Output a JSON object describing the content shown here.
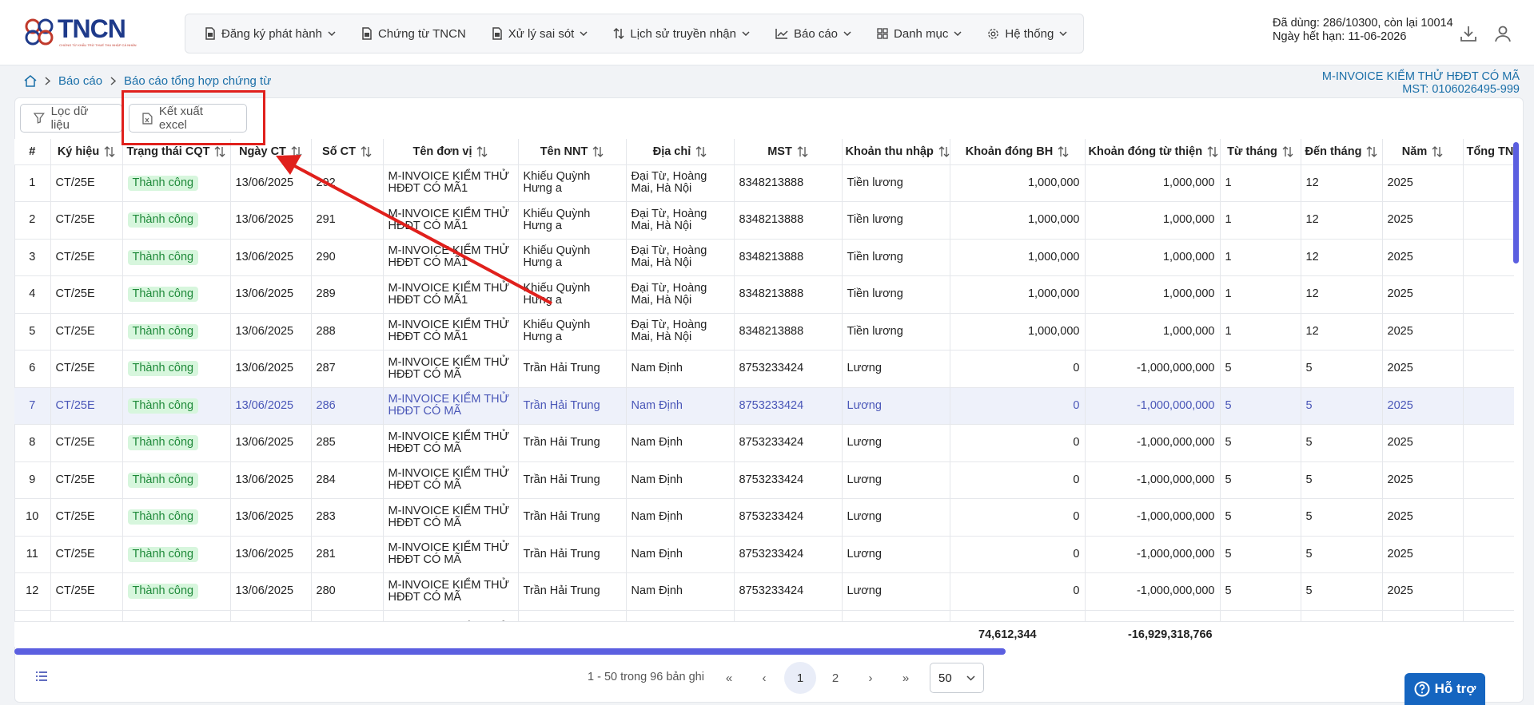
{
  "header": {
    "logo_text": "TNCN",
    "logo_sub": "CHỨNG TỪ KHẤU TRỪ THUẾ THU NHẬP CÁ NHÂN",
    "nav": [
      {
        "label": "Đăng ký phát hành",
        "icon": "document-icon",
        "dropdown": true
      },
      {
        "label": "Chứng từ TNCN",
        "icon": "document-icon",
        "dropdown": false
      },
      {
        "label": "Xử lý sai sót",
        "icon": "document-icon",
        "dropdown": true
      },
      {
        "label": "Lịch sử truyền nhận",
        "icon": "transfer-icon",
        "dropdown": true
      },
      {
        "label": "Báo cáo",
        "icon": "chart-icon",
        "dropdown": true
      },
      {
        "label": "Danh mục",
        "icon": "grid-icon",
        "dropdown": true
      },
      {
        "label": "Hệ thống",
        "icon": "gear-icon",
        "dropdown": true
      }
    ],
    "usage": "Đã dùng: 286/10300, còn lại 10014",
    "expiry": "Ngày hết hạn: 11-06-2026"
  },
  "breadcrumb": {
    "item1": "Báo cáo",
    "item2": "Báo cáo tổng hợp chứng từ"
  },
  "company": {
    "name": "M-INVOICE KIỂM THỬ HĐĐT CÓ MÃ",
    "tax_code": "MST: 0106026495-999"
  },
  "toolbar": {
    "filter_label": "Lọc dữ liệu",
    "export_label": "Kết xuất excel"
  },
  "table": {
    "columns": [
      "#",
      "Ký hiệu",
      "Trạng thái CQT",
      "Ngày CT",
      "Số CT",
      "Tên đơn vị",
      "Tên NNT",
      "Địa chỉ",
      "MST",
      "Khoản thu nhập",
      "Khoản đóng BH",
      "Khoản đóng từ thiện",
      "Từ tháng",
      "Đến tháng",
      "Năm",
      "Tổng TN"
    ],
    "rows": [
      [
        "1",
        "CT/25E",
        "Thành công",
        "13/06/2025",
        "292",
        "M-INVOICE KIỂM THỬ HĐĐT CÓ MÃ1",
        "Khiếu Quỳnh Hưng a",
        "Đại Từ, Hoàng Mai, Hà Nội",
        "8348213888",
        "Tiền lương",
        "1,000,000",
        "1,000,000",
        "1",
        "12",
        "2025"
      ],
      [
        "2",
        "CT/25E",
        "Thành công",
        "13/06/2025",
        "291",
        "M-INVOICE KIỂM THỬ HĐĐT CÓ MÃ1",
        "Khiếu Quỳnh Hưng a",
        "Đại Từ, Hoàng Mai, Hà Nội",
        "8348213888",
        "Tiền lương",
        "1,000,000",
        "1,000,000",
        "1",
        "12",
        "2025"
      ],
      [
        "3",
        "CT/25E",
        "Thành công",
        "13/06/2025",
        "290",
        "M-INVOICE KIỂM THỬ HĐĐT CÓ MÃ1",
        "Khiếu Quỳnh Hưng a",
        "Đại Từ, Hoàng Mai, Hà Nội",
        "8348213888",
        "Tiền lương",
        "1,000,000",
        "1,000,000",
        "1",
        "12",
        "2025"
      ],
      [
        "4",
        "CT/25E",
        "Thành công",
        "13/06/2025",
        "289",
        "M-INVOICE KIỂM THỬ HĐĐT CÓ MÃ1",
        "Khiếu Quỳnh Hưng a",
        "Đại Từ, Hoàng Mai, Hà Nội",
        "8348213888",
        "Tiền lương",
        "1,000,000",
        "1,000,000",
        "1",
        "12",
        "2025"
      ],
      [
        "5",
        "CT/25E",
        "Thành công",
        "13/06/2025",
        "288",
        "M-INVOICE KIỂM THỬ HĐĐT CÓ MÃ1",
        "Khiếu Quỳnh Hưng a",
        "Đại Từ, Hoàng Mai, Hà Nội",
        "8348213888",
        "Tiền lương",
        "1,000,000",
        "1,000,000",
        "1",
        "12",
        "2025"
      ],
      [
        "6",
        "CT/25E",
        "Thành công",
        "13/06/2025",
        "287",
        "M-INVOICE KIỂM THỬ HĐĐT CÓ MÃ",
        "Trần Hải Trung",
        "Nam Định",
        "8753233424",
        "Lương",
        "0",
        "-1,000,000,000",
        "5",
        "5",
        "2025"
      ],
      [
        "7",
        "CT/25E",
        "Thành công",
        "13/06/2025",
        "286",
        "M-INVOICE KIỂM THỬ HĐĐT CÓ MÃ",
        "Trần Hải Trung",
        "Nam Định",
        "8753233424",
        "Lương",
        "0",
        "-1,000,000,000",
        "5",
        "5",
        "2025"
      ],
      [
        "8",
        "CT/25E",
        "Thành công",
        "13/06/2025",
        "285",
        "M-INVOICE KIỂM THỬ HĐĐT CÓ MÃ",
        "Trần Hải Trung",
        "Nam Định",
        "8753233424",
        "Lương",
        "0",
        "-1,000,000,000",
        "5",
        "5",
        "2025"
      ],
      [
        "9",
        "CT/25E",
        "Thành công",
        "13/06/2025",
        "284",
        "M-INVOICE KIỂM THỬ HĐĐT CÓ MÃ",
        "Trần Hải Trung",
        "Nam Định",
        "8753233424",
        "Lương",
        "0",
        "-1,000,000,000",
        "5",
        "5",
        "2025"
      ],
      [
        "10",
        "CT/25E",
        "Thành công",
        "13/06/2025",
        "283",
        "M-INVOICE KIỂM THỬ HĐĐT CÓ MÃ",
        "Trần Hải Trung",
        "Nam Định",
        "8753233424",
        "Lương",
        "0",
        "-1,000,000,000",
        "5",
        "5",
        "2025"
      ],
      [
        "11",
        "CT/25E",
        "Thành công",
        "13/06/2025",
        "281",
        "M-INVOICE KIỂM THỬ HĐĐT CÓ MÃ",
        "Trần Hải Trung",
        "Nam Định",
        "8753233424",
        "Lương",
        "0",
        "-1,000,000,000",
        "5",
        "5",
        "2025"
      ],
      [
        "12",
        "CT/25E",
        "Thành công",
        "13/06/2025",
        "280",
        "M-INVOICE KIỂM THỬ HĐĐT CÓ MÃ",
        "Trần Hải Trung",
        "Nam Định",
        "8753233424",
        "Lương",
        "0",
        "-1,000,000,000",
        "5",
        "5",
        "2025"
      ],
      [
        "",
        "",
        "",
        "",
        "",
        "M-INVOICE KIỂM THỬ",
        "",
        "",
        "",
        "",
        "",
        "",
        "",
        "",
        ""
      ]
    ],
    "highlighted_row": 7,
    "totals": {
      "bh": "74,612,344",
      "tu_thien": "-16,929,318,766"
    }
  },
  "pagination": {
    "info": "1 - 50 trong 96 bản ghi",
    "first": "«",
    "prev": "‹",
    "pages": [
      "1",
      "2"
    ],
    "next": "›",
    "last": "»",
    "page_size": "50"
  },
  "help_label": "Hỗ trợ",
  "colors": {
    "accent": "#1a6fa8",
    "brand": "#1e3a8a",
    "success_bg": "#d7f6dd",
    "success_text": "#1f8a3a",
    "scroll": "#5b5fe0",
    "annotation": "#e0201c",
    "help_bg": "#1565c0"
  }
}
